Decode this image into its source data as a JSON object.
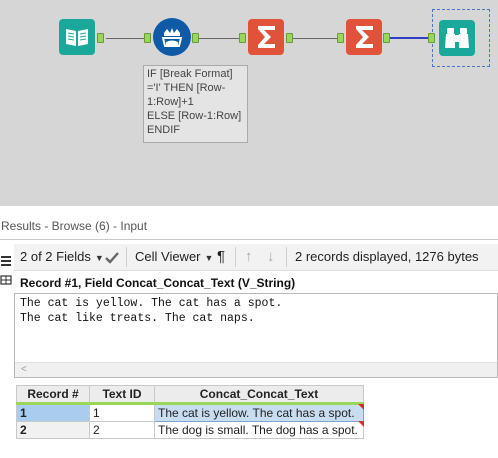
{
  "canvas": {
    "tools": [
      {
        "name": "input-tool",
        "icon": "book-icon",
        "color": "#1aa89a"
      },
      {
        "name": "formula-tool",
        "icon": "crown-formula-icon",
        "color": "#0e5aa7"
      },
      {
        "name": "summarize-tool-1",
        "icon": "sigma-icon",
        "color": "#e0533a"
      },
      {
        "name": "summarize-tool-2",
        "icon": "sigma-icon",
        "color": "#e0533a"
      },
      {
        "name": "browse-tool",
        "icon": "binoculars-icon",
        "color": "#1aa89a"
      }
    ],
    "annotation": "IF [Break Format]\n='I' THEN [Row-\n1:Row]+1\nELSE [Row-1:Row]\nENDIF"
  },
  "results": {
    "title": "Results - Browse (6) - Input",
    "toolbar": {
      "fields": "2 of 2 Fields",
      "viewer": "Cell Viewer",
      "pilcrow": "¶",
      "status": "2 records displayed, 1276 bytes"
    },
    "record_header": "Record #1, Field Concat_Concat_Text (V_String)",
    "cell_text": "The cat is yellow. The cat has a spot.\nThe cat like treats. The cat naps.",
    "grid": {
      "columns": [
        "Record #",
        "Text ID",
        "Concat_Concat_Text"
      ],
      "rows": [
        {
          "record": "1",
          "text_id": "1",
          "text": "The cat is yellow. The cat has a spot."
        },
        {
          "record": "2",
          "text_id": "2",
          "text": "The dog is small. The dog has a spot."
        }
      ]
    }
  },
  "colors": {
    "canvas_bg": "#d6d6d6",
    "anchor_green": "#9ad65a",
    "selection_blue": "#aaccee"
  }
}
